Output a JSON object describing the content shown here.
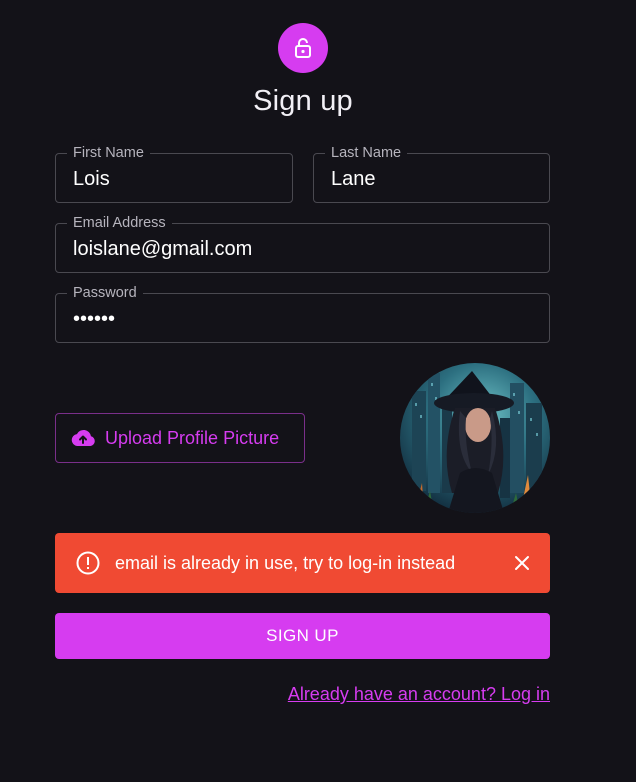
{
  "header": {
    "icon": "lock-open-icon",
    "title": "Sign up"
  },
  "form": {
    "first_name": {
      "label": "First Name",
      "value": "Lois"
    },
    "last_name": {
      "label": "Last Name",
      "value": "Lane"
    },
    "email": {
      "label": "Email Address",
      "value": "loislane@gmail.com"
    },
    "password": {
      "label": "Password",
      "value": "••••••"
    }
  },
  "upload": {
    "icon": "cloud-upload-icon",
    "label": "Upload Profile Picture"
  },
  "profile_picture": {
    "icon": "profile-image"
  },
  "alert": {
    "icon": "error-outline-icon",
    "message": "email is already in use, try to log-in instead",
    "close_icon": "close-icon"
  },
  "actions": {
    "signup_label": "SIGN UP",
    "login_link": "Already have an account? Log in"
  },
  "colors": {
    "accent": "#d63cf0",
    "background": "#131218",
    "error": "#f04a33"
  }
}
